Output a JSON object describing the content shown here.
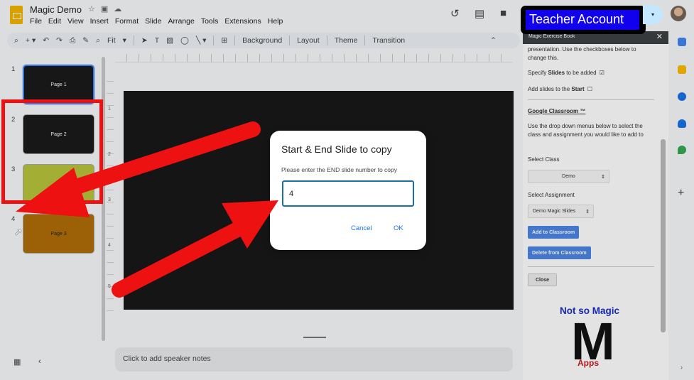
{
  "header": {
    "title": "Magic Demo",
    "menus": [
      "File",
      "Edit",
      "View",
      "Insert",
      "Format",
      "Slide",
      "Arrange",
      "Tools",
      "Extensions",
      "Help"
    ]
  },
  "toolbar": {
    "zoom": "Fit",
    "background": "Background",
    "layout": "Layout",
    "theme": "Theme",
    "transition": "Transition"
  },
  "filmstrip": {
    "slides": [
      {
        "num": "1",
        "label": "Page 1"
      },
      {
        "num": "2",
        "label": "Page 2"
      },
      {
        "num": "3",
        "label": "Pa"
      },
      {
        "num": "4",
        "label": "Page 3"
      }
    ]
  },
  "ruler": {
    "marks": [
      "1",
      "2",
      "3",
      "4",
      "5"
    ]
  },
  "notes": {
    "placeholder": "Click to add speaker notes"
  },
  "dialog": {
    "title": "Start & End Slide to copy",
    "prompt": "Please enter the END slide number to copy",
    "input_value": "4",
    "cancel": "Cancel",
    "ok": "OK"
  },
  "badge": {
    "teacher": "Teacher Account"
  },
  "sidebar": {
    "header": "Magic Exercise Book",
    "intro": "presentation. Use the checkboxes below to change this.",
    "specify_prefix": "Specify ",
    "specify_bold": "Slides",
    "specify_suffix": " to be added",
    "add_start_prefix": "Add slides to the ",
    "add_start_bold": "Start",
    "classroom_heading": "Google Classroom",
    "tm": " ™",
    "classroom_desc": "Use the drop down menus below to select the class and assignment you would like to add to",
    "select_class_label": "Select Class",
    "select_class_value": "Demo",
    "select_assignment_label": "Select Assignment",
    "select_assignment_value": "Demo Magic Slides",
    "add_button": "Add to Classroom",
    "delete_button": "Delete from Classroom",
    "close_button": "Close",
    "logo_top": "Not so Magic",
    "logo_letter": "M",
    "logo_bottom": "Apps"
  },
  "colors": {
    "accent": "#1a73e8",
    "arrow": "#ee1111",
    "badge_bg": "#1100ee"
  }
}
